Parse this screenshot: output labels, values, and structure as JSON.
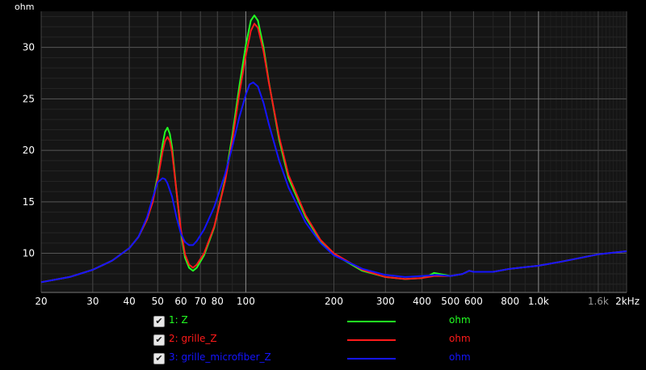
{
  "chart_data": {
    "type": "line",
    "ylabel": "ohm",
    "xlim": [
      20,
      2000
    ],
    "ylim": [
      6.2,
      33.5
    ],
    "xscale": "log",
    "grid": true,
    "background": "#151515",
    "x_ticks": [
      {
        "v": 20,
        "label": "20"
      },
      {
        "v": 30,
        "label": "30"
      },
      {
        "v": 40,
        "label": "40"
      },
      {
        "v": 50,
        "label": "50"
      },
      {
        "v": 60,
        "label": "60"
      },
      {
        "v": 70,
        "label": "70"
      },
      {
        "v": 80,
        "label": "80"
      },
      {
        "v": 100,
        "label": "100"
      },
      {
        "v": 200,
        "label": "200"
      },
      {
        "v": 300,
        "label": "300"
      },
      {
        "v": 400,
        "label": "400"
      },
      {
        "v": 500,
        "label": "500"
      },
      {
        "v": 600,
        "label": "600"
      },
      {
        "v": 800,
        "label": "800"
      },
      {
        "v": 1000,
        "label": "1.0k"
      },
      {
        "v": 1600,
        "label": "1.6k"
      },
      {
        "v": 2000,
        "label": "2kHz"
      }
    ],
    "y_ticks": [
      10,
      15,
      20,
      25,
      30
    ],
    "series": [
      {
        "name": "1: Z",
        "unit": "ohm",
        "color": "#22ff22",
        "checked": true,
        "points": [
          [
            20,
            7.2
          ],
          [
            25,
            7.7
          ],
          [
            30,
            8.4
          ],
          [
            35,
            9.3
          ],
          [
            40,
            10.5
          ],
          [
            43,
            11.6
          ],
          [
            46,
            13.3
          ],
          [
            48,
            15.0
          ],
          [
            50,
            17.5
          ],
          [
            52,
            20.6
          ],
          [
            53,
            21.8
          ],
          [
            54,
            22.2
          ],
          [
            55,
            21.6
          ],
          [
            56,
            20.3
          ],
          [
            58,
            16.0
          ],
          [
            60,
            12.0
          ],
          [
            62,
            9.6
          ],
          [
            64,
            8.6
          ],
          [
            66,
            8.3
          ],
          [
            68,
            8.6
          ],
          [
            72,
            9.8
          ],
          [
            78,
            12.5
          ],
          [
            85,
            17.2
          ],
          [
            90,
            21.5
          ],
          [
            95,
            26.2
          ],
          [
            100,
            30.2
          ],
          [
            104,
            32.6
          ],
          [
            107,
            33.1
          ],
          [
            110,
            32.6
          ],
          [
            115,
            30.0
          ],
          [
            120,
            26.6
          ],
          [
            130,
            21.0
          ],
          [
            140,
            17.3
          ],
          [
            160,
            13.5
          ],
          [
            180,
            11.2
          ],
          [
            200,
            9.9
          ],
          [
            250,
            8.3
          ],
          [
            300,
            7.7
          ],
          [
            350,
            7.5
          ],
          [
            400,
            7.6
          ],
          [
            420,
            7.8
          ],
          [
            440,
            8.1
          ],
          [
            460,
            8.0
          ],
          [
            500,
            7.8
          ],
          [
            550,
            8.0
          ],
          [
            580,
            8.3
          ],
          [
            600,
            8.2
          ],
          [
            700,
            8.2
          ],
          [
            800,
            8.5
          ],
          [
            1000,
            8.8
          ],
          [
            1200,
            9.2
          ],
          [
            1600,
            9.9
          ],
          [
            2000,
            10.2
          ]
        ]
      },
      {
        "name": "2: grille_Z",
        "unit": "ohm",
        "color": "#ff1a1a",
        "checked": true,
        "points": [
          [
            20,
            7.2
          ],
          [
            25,
            7.7
          ],
          [
            30,
            8.4
          ],
          [
            35,
            9.3
          ],
          [
            40,
            10.5
          ],
          [
            43,
            11.6
          ],
          [
            46,
            13.3
          ],
          [
            48,
            14.9
          ],
          [
            50,
            17.2
          ],
          [
            52,
            19.9
          ],
          [
            53,
            20.9
          ],
          [
            54,
            21.3
          ],
          [
            55,
            20.9
          ],
          [
            56,
            19.8
          ],
          [
            58,
            16.0
          ],
          [
            60,
            12.3
          ],
          [
            62,
            9.9
          ],
          [
            64,
            8.9
          ],
          [
            66,
            8.6
          ],
          [
            68,
            8.9
          ],
          [
            72,
            10.0
          ],
          [
            78,
            12.6
          ],
          [
            85,
            17.0
          ],
          [
            90,
            21.0
          ],
          [
            95,
            25.5
          ],
          [
            100,
            29.2
          ],
          [
            104,
            31.6
          ],
          [
            107,
            32.3
          ],
          [
            110,
            31.9
          ],
          [
            115,
            29.6
          ],
          [
            120,
            26.5
          ],
          [
            130,
            21.3
          ],
          [
            140,
            17.6
          ],
          [
            160,
            13.7
          ],
          [
            180,
            11.3
          ],
          [
            200,
            10.0
          ],
          [
            250,
            8.4
          ],
          [
            300,
            7.7
          ],
          [
            350,
            7.5
          ],
          [
            400,
            7.6
          ],
          [
            440,
            7.8
          ],
          [
            500,
            7.8
          ],
          [
            550,
            8.0
          ],
          [
            580,
            8.3
          ],
          [
            600,
            8.2
          ],
          [
            700,
            8.2
          ],
          [
            800,
            8.5
          ],
          [
            1000,
            8.8
          ],
          [
            1200,
            9.2
          ],
          [
            1600,
            9.9
          ],
          [
            2000,
            10.2
          ]
        ]
      },
      {
        "name": "3: grille_microfiber_Z",
        "unit": "ohm",
        "color": "#1414ff",
        "checked": true,
        "points": [
          [
            20,
            7.2
          ],
          [
            25,
            7.7
          ],
          [
            30,
            8.4
          ],
          [
            35,
            9.3
          ],
          [
            40,
            10.5
          ],
          [
            43,
            11.6
          ],
          [
            46,
            13.5
          ],
          [
            48,
            15.3
          ],
          [
            50,
            16.9
          ],
          [
            52,
            17.3
          ],
          [
            53,
            17.2
          ],
          [
            54,
            16.8
          ],
          [
            56,
            15.5
          ],
          [
            58,
            13.5
          ],
          [
            60,
            11.9
          ],
          [
            62,
            11.1
          ],
          [
            64,
            10.8
          ],
          [
            66,
            10.8
          ],
          [
            68,
            11.2
          ],
          [
            72,
            12.3
          ],
          [
            78,
            14.5
          ],
          [
            85,
            17.7
          ],
          [
            90,
            20.4
          ],
          [
            95,
            23.2
          ],
          [
            100,
            25.4
          ],
          [
            103,
            26.4
          ],
          [
            106,
            26.6
          ],
          [
            110,
            26.2
          ],
          [
            115,
            24.6
          ],
          [
            120,
            22.5
          ],
          [
            130,
            19.0
          ],
          [
            140,
            16.4
          ],
          [
            160,
            13.0
          ],
          [
            180,
            11.0
          ],
          [
            200,
            9.8
          ],
          [
            250,
            8.5
          ],
          [
            300,
            7.9
          ],
          [
            350,
            7.7
          ],
          [
            400,
            7.8
          ],
          [
            450,
            7.9
          ],
          [
            500,
            7.8
          ],
          [
            550,
            8.0
          ],
          [
            580,
            8.3
          ],
          [
            600,
            8.2
          ],
          [
            700,
            8.2
          ],
          [
            800,
            8.5
          ],
          [
            1000,
            8.8
          ],
          [
            1200,
            9.2
          ],
          [
            1600,
            9.9
          ],
          [
            2000,
            10.2
          ]
        ]
      }
    ]
  }
}
